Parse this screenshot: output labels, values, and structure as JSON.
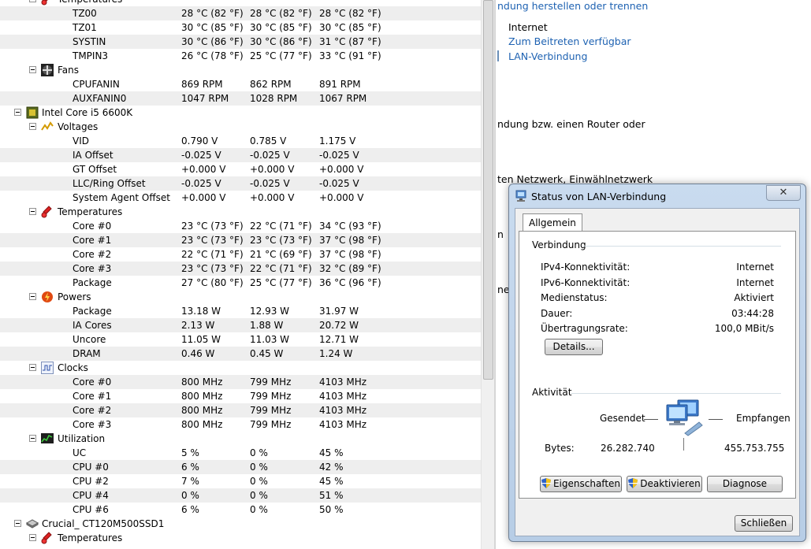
{
  "tree": {
    "rows": [
      {
        "type": "group",
        "label": "Temperatures",
        "indent": 1,
        "icon": "thermometer-icon"
      },
      {
        "type": "value",
        "label": "TZ00",
        "v": [
          "28 °C  (82 °F)",
          "28 °C  (82 °F)",
          "28 °C  (82 °F)"
        ]
      },
      {
        "type": "value",
        "label": "TZ01",
        "v": [
          "30 °C  (85 °F)",
          "30 °C  (85 °F)",
          "30 °C  (85 °F)"
        ]
      },
      {
        "type": "value",
        "label": "SYSTIN",
        "v": [
          "30 °C  (86 °F)",
          "30 °C  (86 °F)",
          "31 °C  (87 °F)"
        ]
      },
      {
        "type": "value",
        "label": "TMPIN3",
        "v": [
          "26 °C  (78 °F)",
          "25 °C  (77 °F)",
          "33 °C  (91 °F)"
        ]
      },
      {
        "type": "group",
        "label": "Fans",
        "indent": 1,
        "icon": "fan-icon"
      },
      {
        "type": "value",
        "label": "CPUFANIN",
        "v": [
          "869 RPM",
          "862 RPM",
          "891 RPM"
        ]
      },
      {
        "type": "value",
        "label": "AUXFANIN0",
        "v": [
          "1047 RPM",
          "1028 RPM",
          "1067 RPM"
        ]
      },
      {
        "type": "device",
        "label": "Intel Core i5 6600K",
        "indent": 0,
        "icon": "cpu-icon"
      },
      {
        "type": "group",
        "label": "Voltages",
        "indent": 1,
        "icon": "voltage-icon"
      },
      {
        "type": "value",
        "label": "VID",
        "v": [
          "0.790 V",
          "0.785 V",
          "1.175 V"
        ]
      },
      {
        "type": "value",
        "label": "IA Offset",
        "v": [
          "-0.025 V",
          "-0.025 V",
          "-0.025 V"
        ]
      },
      {
        "type": "value",
        "label": "GT Offset",
        "v": [
          "+0.000 V",
          "+0.000 V",
          "+0.000 V"
        ]
      },
      {
        "type": "value",
        "label": "LLC/Ring Offset",
        "v": [
          "-0.025 V",
          "-0.025 V",
          "-0.025 V"
        ]
      },
      {
        "type": "value",
        "label": "System Agent Offset",
        "v": [
          "+0.000 V",
          "+0.000 V",
          "+0.000 V"
        ]
      },
      {
        "type": "group",
        "label": "Temperatures",
        "indent": 1,
        "icon": "thermometer-icon"
      },
      {
        "type": "value",
        "label": "Core #0",
        "v": [
          "23 °C  (73 °F)",
          "22 °C  (71 °F)",
          "34 °C  (93 °F)"
        ]
      },
      {
        "type": "value",
        "label": "Core #1",
        "v": [
          "23 °C  (73 °F)",
          "23 °C  (73 °F)",
          "37 °C  (98 °F)"
        ]
      },
      {
        "type": "value",
        "label": "Core #2",
        "v": [
          "22 °C  (71 °F)",
          "21 °C  (69 °F)",
          "37 °C  (98 °F)"
        ]
      },
      {
        "type": "value",
        "label": "Core #3",
        "v": [
          "23 °C  (73 °F)",
          "22 °C  (71 °F)",
          "32 °C  (89 °F)"
        ]
      },
      {
        "type": "value",
        "label": "Package",
        "v": [
          "27 °C  (80 °F)",
          "25 °C  (77 °F)",
          "36 °C  (96 °F)"
        ]
      },
      {
        "type": "group",
        "label": "Powers",
        "indent": 1,
        "icon": "power-icon"
      },
      {
        "type": "value",
        "label": "Package",
        "v": [
          "13.18 W",
          "12.93 W",
          "31.97 W"
        ]
      },
      {
        "type": "value",
        "label": "IA Cores",
        "v": [
          "2.13 W",
          "1.88 W",
          "20.72 W"
        ]
      },
      {
        "type": "value",
        "label": "Uncore",
        "v": [
          "11.05 W",
          "11.03 W",
          "12.71 W"
        ]
      },
      {
        "type": "value",
        "label": "DRAM",
        "v": [
          "0.46 W",
          "0.45 W",
          "1.24 W"
        ]
      },
      {
        "type": "group",
        "label": "Clocks",
        "indent": 1,
        "icon": "clock-wave-icon"
      },
      {
        "type": "value",
        "label": "Core #0",
        "v": [
          "800 MHz",
          "799 MHz",
          "4103 MHz"
        ]
      },
      {
        "type": "value",
        "label": "Core #1",
        "v": [
          "800 MHz",
          "799 MHz",
          "4103 MHz"
        ]
      },
      {
        "type": "value",
        "label": "Core #2",
        "v": [
          "800 MHz",
          "799 MHz",
          "4103 MHz"
        ]
      },
      {
        "type": "value",
        "label": "Core #3",
        "v": [
          "800 MHz",
          "799 MHz",
          "4103 MHz"
        ]
      },
      {
        "type": "group",
        "label": "Utilization",
        "indent": 1,
        "icon": "utilization-icon"
      },
      {
        "type": "value",
        "label": "UC",
        "v": [
          "5 %",
          "0 %",
          "45 %"
        ]
      },
      {
        "type": "value",
        "label": "CPU #0",
        "v": [
          "6 %",
          "0 %",
          "42 %"
        ]
      },
      {
        "type": "value",
        "label": "CPU #2",
        "v": [
          "7 %",
          "0 %",
          "45 %"
        ]
      },
      {
        "type": "value",
        "label": "CPU #4",
        "v": [
          "0 %",
          "0 %",
          "51 %"
        ]
      },
      {
        "type": "value",
        "label": "CPU #6",
        "v": [
          "6 %",
          "0 %",
          "50 %"
        ]
      },
      {
        "type": "device",
        "label": "Crucial_ CT120M500SSD1",
        "indent": 0,
        "icon": "drive-icon"
      },
      {
        "type": "group",
        "label": "Temperatures",
        "indent": 1,
        "icon": "thermometer-icon"
      }
    ]
  },
  "background": {
    "link_top": "ndung herstellen oder trennen",
    "internet": "Internet",
    "join_link": "Zum Beitreten verfügbar",
    "lan_link": "LAN-Verbindung",
    "router_text": "ndung bzw. einen Router oder",
    "network_text": "ten Netzwerk, Einwählnetzwerk",
    "frag1": "n",
    "frag2": "ne"
  },
  "dialog": {
    "title": "Status von LAN-Verbindung",
    "close_glyph": "✕",
    "tab": "Allgemein",
    "connection_group": "Verbindung",
    "fields": [
      {
        "label": "IPv4-Konnektivität:",
        "value": "Internet"
      },
      {
        "label": "IPv6-Konnektivität:",
        "value": "Internet"
      },
      {
        "label": "Medienstatus:",
        "value": "Aktiviert"
      },
      {
        "label": "Dauer:",
        "value": "03:44:28"
      },
      {
        "label": "Übertragungsrate:",
        "value": "100,0 MBit/s"
      }
    ],
    "details_button": "Details...",
    "activity_group": "Aktivität",
    "sent_label": "Gesendet",
    "received_label": "Empfangen",
    "bytes_label": "Bytes:",
    "bytes_sent": "26.282.740",
    "bytes_received": "455.753.755",
    "properties_button": "Eigenschaften",
    "deactivate_button": "Deaktivieren",
    "diagnose_button": "Diagnose",
    "close_button": "Schließen"
  }
}
